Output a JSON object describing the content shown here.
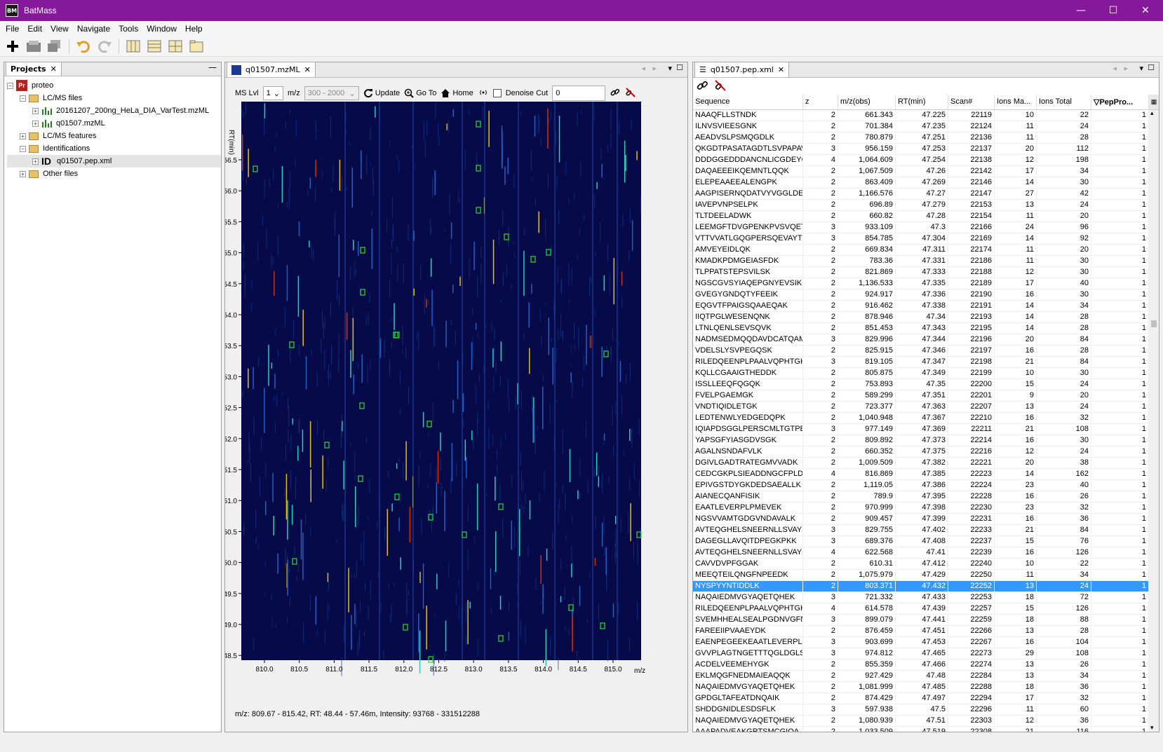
{
  "app": {
    "title": "BatMass",
    "icon_text": "BM"
  },
  "menu": [
    "File",
    "Edit",
    "View",
    "Navigate",
    "Tools",
    "Window",
    "Help"
  ],
  "projects": {
    "tab_label": "Projects",
    "tree": [
      {
        "label": "proteo",
        "level": 0,
        "icon": "project-icon",
        "icon_text": "Pr"
      },
      {
        "label": "LC/MS files",
        "level": 1,
        "icon": "folder-icon"
      },
      {
        "label": "20161207_200ng_HeLa_DIA_VarTest.mzML",
        "level": 2,
        "icon": "mzml-file-icon"
      },
      {
        "label": "q01507.mzML",
        "level": 2,
        "icon": "mzml-file-icon"
      },
      {
        "label": "LC/MS features",
        "level": 1,
        "icon": "folder-icon"
      },
      {
        "label": "Identifications",
        "level": 1,
        "icon": "folder-icon"
      },
      {
        "label": "q01507.pep.xml",
        "level": 2,
        "icon": "id-icon",
        "icon_text": "ID"
      },
      {
        "label": "Other files",
        "level": 1,
        "icon": "folder-icon"
      }
    ]
  },
  "map_panel": {
    "tab_label": "q01507.mzML",
    "ms_lvl_label": "MS Lvl",
    "ms_lvl_value": "1",
    "mz_label": "m/z",
    "mz_range": "300 - 2000",
    "update_label": "Update",
    "goto_label": "Go To",
    "home_label": "Home",
    "denoise_label": "Denoise Cut",
    "denoise_value": "0",
    "y_axis_label": "RT(min)",
    "x_axis_label": "m/z",
    "x_ticks": [
      "810.0",
      "810.5",
      "811.0",
      "811.5",
      "812.0",
      "812.5",
      "813.0",
      "813.5",
      "814.0",
      "814.5",
      "815.0"
    ],
    "y_ticks": [
      "56.5",
      "56.0",
      "55.5",
      "55.0",
      "54.5",
      "54.0",
      "53.5",
      "53.0",
      "52.5",
      "52.0",
      "51.5",
      "51.0",
      "50.5",
      "50.0",
      "49.5",
      "49.0",
      "48.5"
    ],
    "status": "m/z: 809.67 - 815.42, RT: 48.44 - 57.46m, Intensity: 93768 - 331512288",
    "colors": {
      "background": "#060a48",
      "peak_low": "#2060c0",
      "peak_mid": "#20d0c0",
      "peak_high": "#e0c020",
      "peak_max": "#d03010",
      "marker": "#30e030"
    }
  },
  "table_panel": {
    "tab_label": "q01507.pep.xml",
    "columns": [
      "Sequence",
      "z",
      "m/z(obs)",
      "RT(min)",
      "Scan#",
      "Ions Ma...",
      "Ions Total",
      "PepPro..."
    ],
    "selected_index": 42,
    "rows": [
      [
        "NAAQFLLSTNDK",
        "2",
        "661.343",
        "47.225",
        "22119",
        "10",
        "22",
        "1"
      ],
      [
        "ILNVSVIEESGNK",
        "2",
        "701.384",
        "47.235",
        "22124",
        "11",
        "24",
        "1"
      ],
      [
        "AEADVSLPSMQGDLK",
        "2",
        "780.879",
        "47.251",
        "22136",
        "11",
        "28",
        "1"
      ],
      [
        "QKGDTPASATAGDTLSVPAPAV...",
        "3",
        "956.159",
        "47.253",
        "22137",
        "20",
        "112",
        "1"
      ],
      [
        "DDDGGEDDDANCNLICGDEYG...",
        "4",
        "1,064.609",
        "47.254",
        "22138",
        "12",
        "198",
        "1"
      ],
      [
        "DAQAEEEIKQEMNTLQQK",
        "2",
        "1,067.509",
        "47.26",
        "22142",
        "17",
        "34",
        "1"
      ],
      [
        "ELEPEAAEEALENGPK",
        "2",
        "863.409",
        "47.269",
        "22146",
        "14",
        "30",
        "1"
      ],
      [
        "AAGPISERNQDATVYVGGLDEK",
        "2",
        "1,166.576",
        "47.27",
        "22147",
        "27",
        "42",
        "1"
      ],
      [
        "IAVEPVNPSELPK",
        "2",
        "696.89",
        "47.279",
        "22153",
        "13",
        "24",
        "1"
      ],
      [
        "TLTDEELADWK",
        "2",
        "660.82",
        "47.28",
        "22154",
        "11",
        "20",
        "1"
      ],
      [
        "LEEMGFTDVGPENKPVSVQETY...",
        "3",
        "933.109",
        "47.3",
        "22166",
        "24",
        "96",
        "1"
      ],
      [
        "VTTVVATLGQGPERSQEVAYTDIK",
        "3",
        "854.785",
        "47.304",
        "22169",
        "14",
        "92",
        "1"
      ],
      [
        "AMVEYEIDLQK",
        "2",
        "669.834",
        "47.311",
        "22174",
        "11",
        "20",
        "1"
      ],
      [
        "KMADKPDMGEIASFDK",
        "2",
        "783.36",
        "47.331",
        "22186",
        "11",
        "30",
        "1"
      ],
      [
        "TLPPATSTEPSVILSK",
        "2",
        "821.869",
        "47.333",
        "22188",
        "12",
        "30",
        "1"
      ],
      [
        "NGSCGVSYIAQEPGNYEVSIK",
        "2",
        "1,136.533",
        "47.335",
        "22189",
        "17",
        "40",
        "1"
      ],
      [
        "GVEGYGNDQTYFEEIK",
        "2",
        "924.917",
        "47.336",
        "22190",
        "16",
        "30",
        "1"
      ],
      [
        "EQGVTFPAIGSQAAEQAK",
        "2",
        "916.462",
        "47.338",
        "22191",
        "14",
        "34",
        "1"
      ],
      [
        "IIQTPGLWESENQNK",
        "2",
        "878.946",
        "47.34",
        "22193",
        "14",
        "28",
        "1"
      ],
      [
        "LTNLQENLSEVSQVK",
        "2",
        "851.453",
        "47.343",
        "22195",
        "14",
        "28",
        "1"
      ],
      [
        "NADMSEDMQQDAVDCATQAMEK",
        "3",
        "829.996",
        "47.344",
        "22196",
        "20",
        "84",
        "1"
      ],
      [
        "VDELSLYSVPEGQSK",
        "2",
        "825.915",
        "47.346",
        "22197",
        "16",
        "28",
        "1"
      ],
      [
        "RILEDQEENPLPAALVQPHTGK",
        "3",
        "819.105",
        "47.347",
        "22198",
        "21",
        "84",
        "1"
      ],
      [
        "KQLLCGAAIGTHEDDK",
        "2",
        "805.875",
        "47.349",
        "22199",
        "10",
        "30",
        "1"
      ],
      [
        "ISSLLEEQFQGQK",
        "2",
        "753.893",
        "47.35",
        "22200",
        "15",
        "24",
        "1"
      ],
      [
        "FVELPGAEMGK",
        "2",
        "589.299",
        "47.351",
        "22201",
        "9",
        "20",
        "1"
      ],
      [
        "VNDTIQIDLETGK",
        "2",
        "723.377",
        "47.363",
        "22207",
        "13",
        "24",
        "1"
      ],
      [
        "LEDTENWLYEDGEDQPK",
        "2",
        "1,040.948",
        "47.367",
        "22210",
        "16",
        "32",
        "1"
      ],
      [
        "IQIAPDSGGLPERSCMLTGTPES...",
        "3",
        "977.149",
        "47.369",
        "22211",
        "21",
        "108",
        "1"
      ],
      [
        "YAPSGFYIASGDVSGK",
        "2",
        "809.892",
        "47.373",
        "22214",
        "16",
        "30",
        "1"
      ],
      [
        "AGALNSNDAFVLK",
        "2",
        "660.352",
        "47.375",
        "22216",
        "12",
        "24",
        "1"
      ],
      [
        "DGIVLGADTRATEGMVVADK",
        "2",
        "1,009.509",
        "47.382",
        "22221",
        "20",
        "38",
        "1"
      ],
      [
        "CEDCGKPLSIEADDNGCFPLDG...",
        "4",
        "816.869",
        "47.385",
        "22223",
        "14",
        "162",
        "1"
      ],
      [
        "EPIVGSTDYGKDEDSAEALLK",
        "2",
        "1,119.05",
        "47.386",
        "22224",
        "23",
        "40",
        "1"
      ],
      [
        "AIANECQANFISIK",
        "2",
        "789.9",
        "47.395",
        "22228",
        "16",
        "26",
        "1"
      ],
      [
        "EAATLEVERPLPMEVEK",
        "2",
        "970.999",
        "47.398",
        "22230",
        "23",
        "32",
        "1"
      ],
      [
        "NGSVVAMTGDGVNDAVALK",
        "2",
        "909.457",
        "47.399",
        "22231",
        "16",
        "36",
        "1"
      ],
      [
        "AVTEQGHELSNEERNLLSVAYK",
        "3",
        "829.755",
        "47.402",
        "22233",
        "21",
        "84",
        "1"
      ],
      [
        "DAGEGLLAVQITDPEGKPKK",
        "3",
        "689.376",
        "47.408",
        "22237",
        "15",
        "76",
        "1"
      ],
      [
        "AVTEQGHELSNEERNLLSVAYK",
        "4",
        "622.568",
        "47.41",
        "22239",
        "16",
        "126",
        "1"
      ],
      [
        "CAVVDVPFGGAK",
        "2",
        "610.31",
        "47.412",
        "22240",
        "10",
        "22",
        "1"
      ],
      [
        "MEEQTEILQNGFNPEEDK",
        "2",
        "1,075.979",
        "47.429",
        "22250",
        "11",
        "34",
        "1"
      ],
      [
        "NYSPYYNTIDDLK",
        "2",
        "803.371",
        "47.432",
        "22252",
        "13",
        "24",
        "1"
      ],
      [
        "NAQAIEDMVGYAQETQHEK",
        "3",
        "721.332",
        "47.433",
        "22253",
        "18",
        "72",
        "1"
      ],
      [
        "RILEDQEENPLPAALVQPHTGK",
        "4",
        "614.578",
        "47.439",
        "22257",
        "15",
        "126",
        "1"
      ],
      [
        "SVEMHHEALSEALPGDNVGFNVK",
        "3",
        "899.079",
        "47.441",
        "22259",
        "18",
        "88",
        "1"
      ],
      [
        "FAREEIIPVAAEYDK",
        "2",
        "876.459",
        "47.451",
        "22266",
        "13",
        "28",
        "1"
      ],
      [
        "EAENPEGEEKEAATLEVERPLP...",
        "3",
        "903.699",
        "47.453",
        "22267",
        "16",
        "104",
        "1"
      ],
      [
        "GVVPLAGTNGETTTQGLDGLSE...",
        "3",
        "974.812",
        "47.465",
        "22273",
        "29",
        "108",
        "1"
      ],
      [
        "ACDELVEEMEHYGK",
        "2",
        "855.359",
        "47.466",
        "22274",
        "13",
        "26",
        "1"
      ],
      [
        "EKLMQGFNEDMAIEAQQK",
        "2",
        "927.429",
        "47.48",
        "22284",
        "13",
        "34",
        "1"
      ],
      [
        "NAQAIEDMVGYAQETQHEK",
        "2",
        "1,081.999",
        "47.485",
        "22288",
        "18",
        "36",
        "1"
      ],
      [
        "GPDGLTAFEATDNQAIK",
        "2",
        "874.429",
        "47.497",
        "22294",
        "17",
        "32",
        "1"
      ],
      [
        "SHDDGNIDLESDSFLK",
        "3",
        "597.938",
        "47.5",
        "22296",
        "11",
        "60",
        "1"
      ],
      [
        "NAQAIEDMVGYAQETQHEK",
        "2",
        "1,080.939",
        "47.51",
        "22303",
        "12",
        "36",
        "1"
      ],
      [
        "AAAPADVEAKGRTSMCGIQA",
        "2",
        "1,033.509",
        "47.519",
        "22308",
        "21",
        "116",
        "1"
      ]
    ]
  }
}
